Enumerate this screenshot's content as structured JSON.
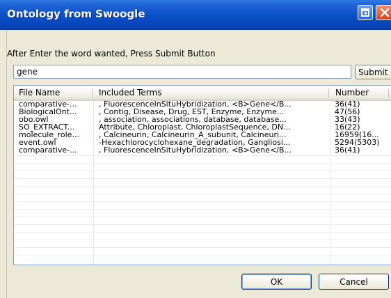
{
  "window": {
    "title": "Ontology from Swoogle"
  },
  "icons": {
    "restore": "restore-window-icon",
    "close": "close-icon"
  },
  "form": {
    "prompt": "After Enter the word wanted, Press Submit Button",
    "search_value": "gene",
    "submit_label": "Submit"
  },
  "table": {
    "columns": [
      "File Name",
      "Included Terms",
      "Number"
    ],
    "rows": [
      {
        "file": "comparative-...",
        "terms": ", FluorescenceInSituHybridization, <B>Gene</B...",
        "number": "36(41)"
      },
      {
        "file": "BiologicalOnt...",
        "terms": ", Contig, Disease, Drug, EST, Enzyme, Enzyme...",
        "number": "47(56)"
      },
      {
        "file": "obo.owl",
        "terms": ", association, associations, database, database...",
        "number": "33(43)"
      },
      {
        "file": "SO_EXTRACT...",
        "terms": "Attribute, Chloroplast, ChloroplastSequence, DN...",
        "number": "16(22)"
      },
      {
        "file": "molecule_role...",
        "terms": ", Calcineurin, Calcineurin_A_subunit, Calcineuri...",
        "number": "16959(16..."
      },
      {
        "file": "event.owl",
        "terms": "-Hexachlorocyclohexane_degradation, Gangliosi...",
        "number": "5294(5303)"
      },
      {
        "file": "comparative-...",
        "terms": ", FluorescenceInSituHybridization, <B>Gene</B...",
        "number": "36(41)"
      }
    ]
  },
  "buttons": {
    "ok_label": "OK",
    "cancel_label": "Cancel"
  }
}
